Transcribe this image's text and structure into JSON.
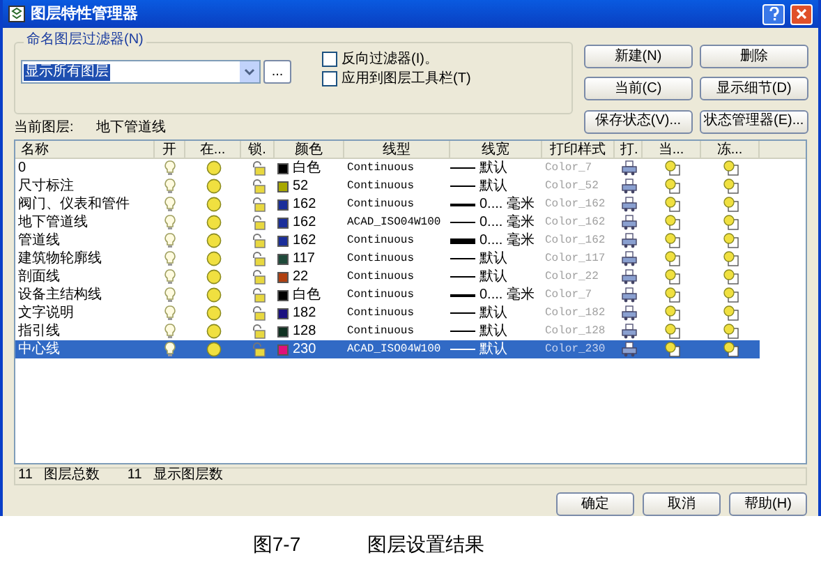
{
  "window": {
    "title": "图层特性管理器"
  },
  "filter_group": {
    "label": "命名图层过滤器(N)",
    "value": "显示所有图层",
    "browse": "..."
  },
  "options": [
    {
      "label": "反向过滤器(I)。",
      "checked": false
    },
    {
      "label": "应用到图层工具栏(T)",
      "checked": false
    }
  ],
  "buttons": [
    "新建(N)",
    "删除",
    "当前(C)",
    "显示细节(D)",
    "保存状态(V)...",
    "状态管理器(E)..."
  ],
  "current_layer": {
    "label": "当前图层:",
    "value": "地下管道线"
  },
  "table": {
    "columns": [
      "名称",
      "开",
      "在...",
      "锁.",
      "颜色",
      "线型",
      "线宽",
      "打印样式",
      "打.",
      "当...",
      "冻..."
    ],
    "rows": [
      {
        "name": "0",
        "color": "#000000",
        "color_label": "白色",
        "linetype": "Continuous",
        "kind": "thin",
        "lineweight": "默认",
        "plot_style": "Color_7",
        "selected": false
      },
      {
        "name": "尺寸标注",
        "color": "#a8a800",
        "color_label": "52",
        "linetype": "Continuous",
        "kind": "thin",
        "lineweight": "默认",
        "plot_style": "Color_52",
        "selected": false
      },
      {
        "name": "阀门、仪表和管件",
        "color": "#1a2e9a",
        "color_label": "162",
        "linetype": "Continuous",
        "kind": "medium",
        "lineweight": "0.... 毫米",
        "plot_style": "Color_162",
        "selected": false
      },
      {
        "name": "地下管道线",
        "color": "#1a2e9a",
        "color_label": "162",
        "linetype": "ACAD_ISO04W100",
        "kind": "thin",
        "lineweight": "0.... 毫米",
        "plot_style": "Color_162",
        "selected": false
      },
      {
        "name": "管道线",
        "color": "#1a2e9a",
        "color_label": "162",
        "linetype": "Continuous",
        "kind": "heavy",
        "lineweight": "0.... 毫米",
        "plot_style": "Color_162",
        "selected": false
      },
      {
        "name": "建筑物轮廓线",
        "color": "#1f4a3a",
        "color_label": "117",
        "linetype": "Continuous",
        "kind": "thin",
        "lineweight": "默认",
        "plot_style": "Color_117",
        "selected": false
      },
      {
        "name": "剖面线",
        "color": "#b04010",
        "color_label": "22",
        "linetype": "Continuous",
        "kind": "thin",
        "lineweight": "默认",
        "plot_style": "Color_22",
        "selected": false
      },
      {
        "name": "设备主结构线",
        "color": "#000000",
        "color_label": "白色",
        "linetype": "Continuous",
        "kind": "medium",
        "lineweight": "0.... 毫米",
        "plot_style": "Color_7",
        "selected": false
      },
      {
        "name": "文字说明",
        "color": "#1a1080",
        "color_label": "182",
        "linetype": "Continuous",
        "kind": "thin",
        "lineweight": "默认",
        "plot_style": "Color_182",
        "selected": false
      },
      {
        "name": "指引线",
        "color": "#0f3020",
        "color_label": "128",
        "linetype": "Continuous",
        "kind": "thin",
        "lineweight": "默认",
        "plot_style": "Color_128",
        "selected": false
      },
      {
        "name": "中心线",
        "color": "#e0107a",
        "color_label": "230",
        "linetype": "ACAD_ISO04W100",
        "kind": "thin",
        "lineweight": "默认",
        "plot_style": "Color_230",
        "selected": true
      }
    ]
  },
  "status_bar": {
    "total": "11",
    "total_label": "图层总数",
    "shown": "11",
    "shown_label": "显示图层数"
  },
  "footer_buttons": [
    "确定",
    "取消",
    "帮助(H)"
  ],
  "caption": {
    "figure": "图7-7",
    "text": "图层设置结果"
  }
}
